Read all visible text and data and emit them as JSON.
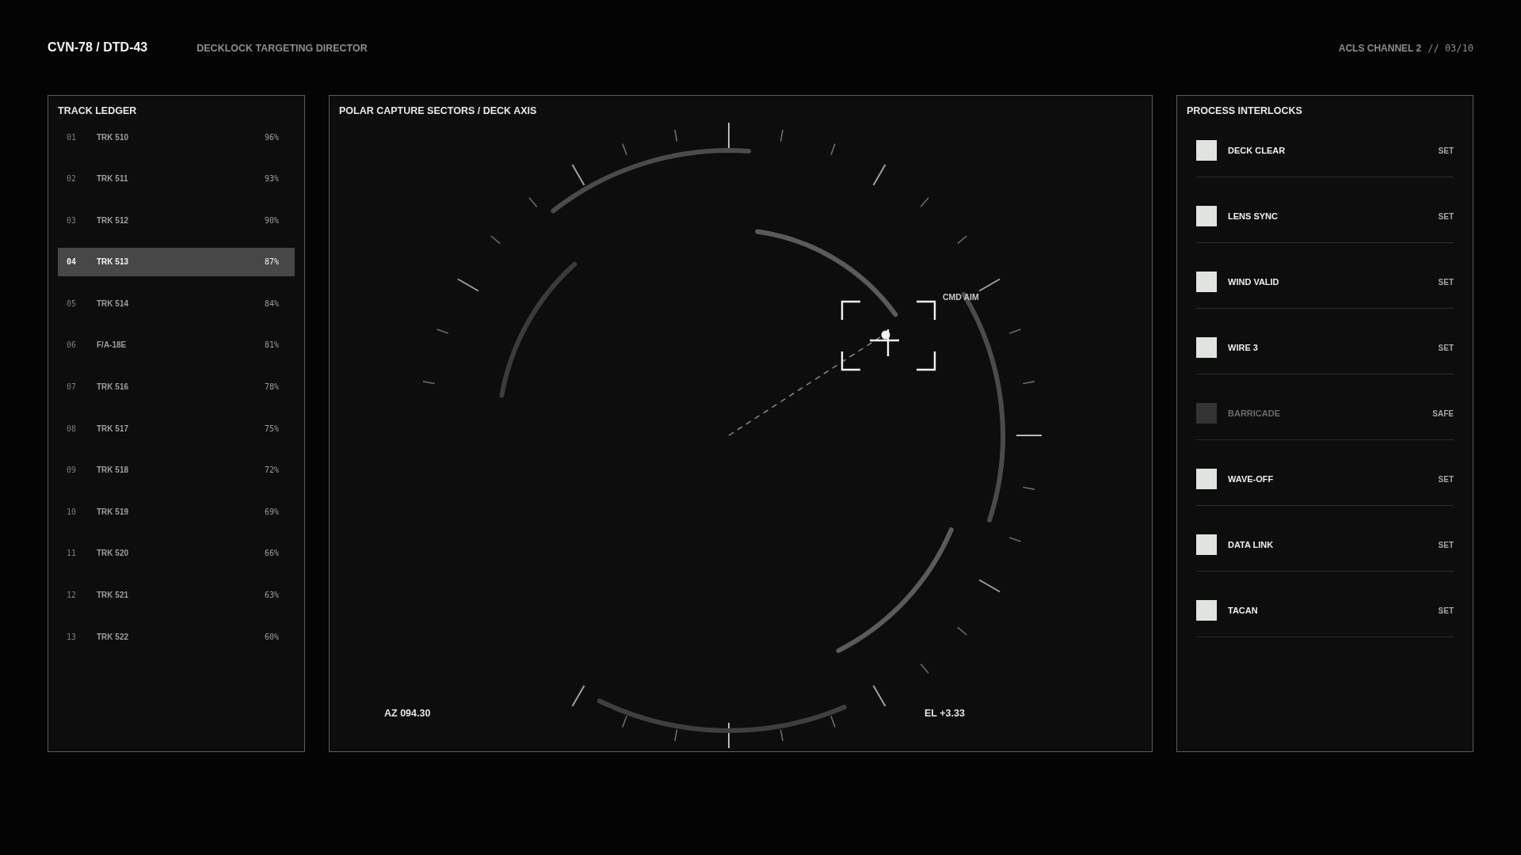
{
  "header": {
    "title": "CVN-78 / DTD-43",
    "subtitle": "DECKLOCK TARGETING DIRECTOR",
    "channel": "ACLS CHANNEL 2",
    "frame": "// 03/10"
  },
  "track_ledger": {
    "title": "TRACK LEDGER",
    "rows": [
      {
        "index": "01",
        "name": "TRK 510",
        "confidence": "96%",
        "selected": false
      },
      {
        "index": "02",
        "name": "TRK 511",
        "confidence": "93%",
        "selected": false
      },
      {
        "index": "03",
        "name": "TRK 512",
        "confidence": "90%",
        "selected": false
      },
      {
        "index": "04",
        "name": "TRK 513",
        "confidence": "87%",
        "selected": true
      },
      {
        "index": "05",
        "name": "TRK 514",
        "confidence": "84%",
        "selected": false
      },
      {
        "index": "06",
        "name": "F/A-18E",
        "confidence": "81%",
        "selected": false
      },
      {
        "index": "07",
        "name": "TRK 516",
        "confidence": "78%",
        "selected": false
      },
      {
        "index": "08",
        "name": "TRK 517",
        "confidence": "75%",
        "selected": false
      },
      {
        "index": "09",
        "name": "TRK 518",
        "confidence": "72%",
        "selected": false
      },
      {
        "index": "10",
        "name": "TRK 519",
        "confidence": "69%",
        "selected": false
      },
      {
        "index": "11",
        "name": "TRK 520",
        "confidence": "66%",
        "selected": false
      },
      {
        "index": "12",
        "name": "TRK 521",
        "confidence": "63%",
        "selected": false
      },
      {
        "index": "13",
        "name": "TRK 522",
        "confidence": "60%",
        "selected": false
      }
    ]
  },
  "polar": {
    "title": "POLAR CAPTURE SECTORS / DECK AXIS",
    "target_label": "CMD AIM",
    "azimuth": "AZ 094.30",
    "elevation": "EL +3.33"
  },
  "interlocks": {
    "title": "PROCESS INTERLOCKS",
    "items": [
      {
        "label": "DECK CLEAR",
        "checked": true,
        "status": "SET"
      },
      {
        "label": "LENS SYNC",
        "checked": true,
        "status": "SET"
      },
      {
        "label": "WIND VALID",
        "checked": true,
        "status": "SET"
      },
      {
        "label": "WIRE 3",
        "checked": true,
        "status": "SET"
      },
      {
        "label": "BARRICADE",
        "checked": false,
        "status": "SAFE"
      },
      {
        "label": "WAVE-OFF",
        "checked": true,
        "status": "SET"
      },
      {
        "label": "DATA LINK",
        "checked": true,
        "status": "SET"
      },
      {
        "label": "TACAN",
        "checked": true,
        "status": "SET"
      }
    ]
  }
}
